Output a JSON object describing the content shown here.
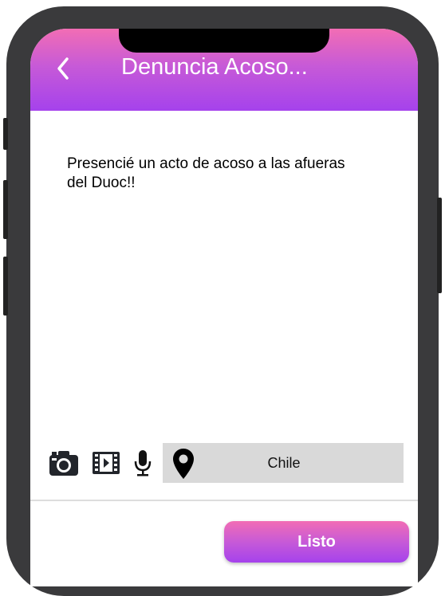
{
  "header": {
    "title": "Denuncia Acoso...",
    "back_icon": "chevron-left-icon",
    "gradient_top": "#f26db4",
    "gradient_bottom": "#a542ec"
  },
  "report": {
    "text": "Presencié un acto de acoso a las afueras del Duoc!!"
  },
  "toolbar": {
    "icons": [
      "camera-icon",
      "video-icon",
      "microphone-icon"
    ],
    "location_icon": "map-pin-icon",
    "location": "Chile"
  },
  "actions": {
    "done_label": "Listo"
  }
}
